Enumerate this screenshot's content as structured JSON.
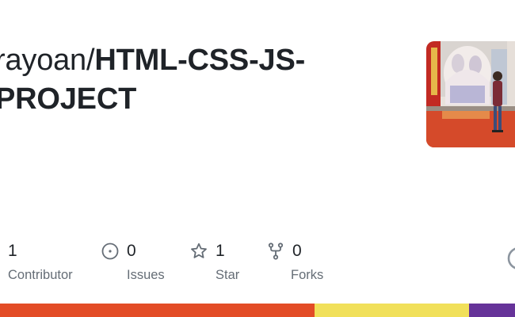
{
  "repo": {
    "owner": "rayoan",
    "separator": "/",
    "name_line1": "HTML-CSS-JS-",
    "name_line2": "PROJECT"
  },
  "stats": [
    {
      "value": "1",
      "label": "Contributor",
      "icon": "people-icon"
    },
    {
      "value": "0",
      "label": "Issues",
      "icon": "issue-opened-icon"
    },
    {
      "value": "1",
      "label": "Star",
      "icon": "star-icon"
    },
    {
      "value": "0",
      "label": "Forks",
      "icon": "repo-forked-icon"
    }
  ],
  "language_bar": [
    {
      "color": "#e34c26",
      "share": 0.61
    },
    {
      "color": "#f1e05a",
      "share": 0.3
    },
    {
      "color": "#663399",
      "share": 0.09
    }
  ],
  "colors": {
    "text": "#1f2328",
    "muted": "#656d76"
  }
}
